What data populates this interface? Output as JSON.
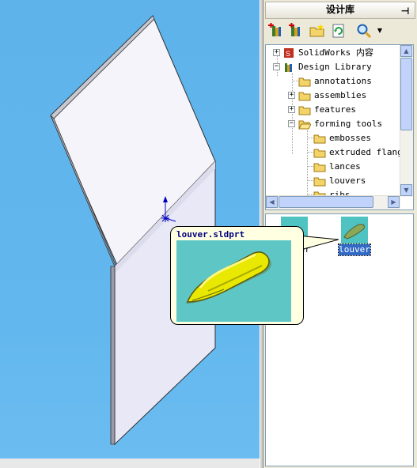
{
  "pane": {
    "title": "设计库",
    "pin_icon": "pin-icon",
    "toolbar": [
      {
        "name": "add-to-library-button",
        "icon": "add-to-library-icon"
      },
      {
        "name": "add-file-location-button",
        "icon": "add-location-icon"
      },
      {
        "name": "create-new-folder-button",
        "icon": "new-folder-icon"
      },
      {
        "name": "refresh-button",
        "icon": "refresh-icon"
      },
      {
        "name": "search-button",
        "icon": "search-icon"
      }
    ]
  },
  "tree": {
    "items": [
      {
        "label": "SolidWorks 内容",
        "icon": "solidworks-content-icon",
        "expander": "+"
      },
      {
        "label": "Design Library",
        "icon": "design-library-icon",
        "expander": "−"
      },
      {
        "label": "annotations",
        "icon": "folder-icon",
        "expander": ""
      },
      {
        "label": "assemblies",
        "icon": "folder-icon",
        "expander": "+"
      },
      {
        "label": "features",
        "icon": "folder-icon",
        "expander": "+"
      },
      {
        "label": "forming tools",
        "icon": "folder-icon",
        "expander": "−"
      },
      {
        "label": "embosses",
        "icon": "folder-icon",
        "expander": ""
      },
      {
        "label": "extruded flanges",
        "icon": "folder-icon",
        "expander": ""
      },
      {
        "label": "lances",
        "icon": "folder-icon",
        "expander": ""
      },
      {
        "label": "louvers",
        "icon": "folder-icon",
        "expander": ""
      },
      {
        "label": "ribs",
        "icon": "folder-icon",
        "expander": ""
      }
    ]
  },
  "gallery": {
    "items": [
      {
        "label": "louver",
        "selected": false
      },
      {
        "label": "louver",
        "selected": true
      }
    ]
  },
  "tooltip": {
    "title": "louver.sldprt"
  },
  "colors": {
    "viewport_bg": "#62b8ee",
    "selection": "#316ac5",
    "tooltip_bg": "#ffffe1",
    "part_yellow": "#e8e800"
  }
}
